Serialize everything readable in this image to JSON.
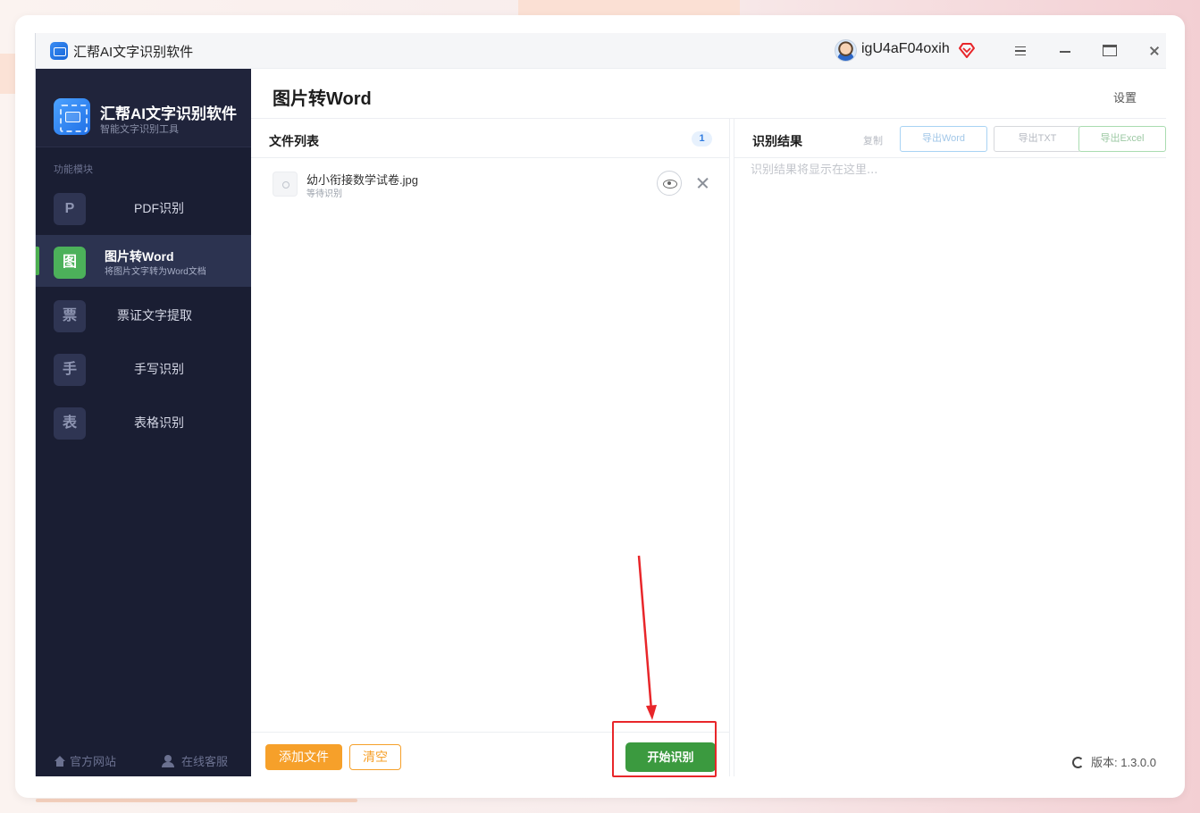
{
  "window": {
    "title": "汇帮AI文字识别软件",
    "username": "igU4aF04oxih"
  },
  "sidebar": {
    "brand": "汇帮AI文字识别软件",
    "subtitle": "智能文字识别工具",
    "section_label": "功能模块",
    "items": [
      {
        "badge": "P",
        "label": "PDF识别",
        "desc": ""
      },
      {
        "badge": "图",
        "label": "图片转Word",
        "desc": "将图片文字转为Word文档"
      },
      {
        "badge": "票",
        "label": "票证文字提取",
        "desc": ""
      },
      {
        "badge": "手",
        "label": "手写识别",
        "desc": ""
      },
      {
        "badge": "表",
        "label": "表格识别",
        "desc": ""
      }
    ],
    "footer_website": "官方网站",
    "footer_support": "在线客服"
  },
  "main": {
    "title": "图片转Word",
    "settings_label": "设置"
  },
  "file_panel": {
    "title": "文件列表",
    "count": "1",
    "files": [
      {
        "name": "幼小衔接数学试卷.jpg",
        "status": "等待识别"
      }
    ],
    "add_label": "添加文件",
    "clear_label": "清空",
    "start_label": "开始识别"
  },
  "result_panel": {
    "title": "识别结果",
    "copy_label": "复制",
    "export_word": "导出Word",
    "export_txt": "导出TXT",
    "export_excel": "导出Excel",
    "placeholder": "识别结果将显示在这里...",
    "version": "版本: 1.3.0.0"
  },
  "colors": {
    "sidebar_bg": "#1a1e33",
    "active_green": "#4cb15a",
    "start_button": "#3b9a3f",
    "add_button": "#f6a02a",
    "annotation_red": "#e8262a"
  }
}
